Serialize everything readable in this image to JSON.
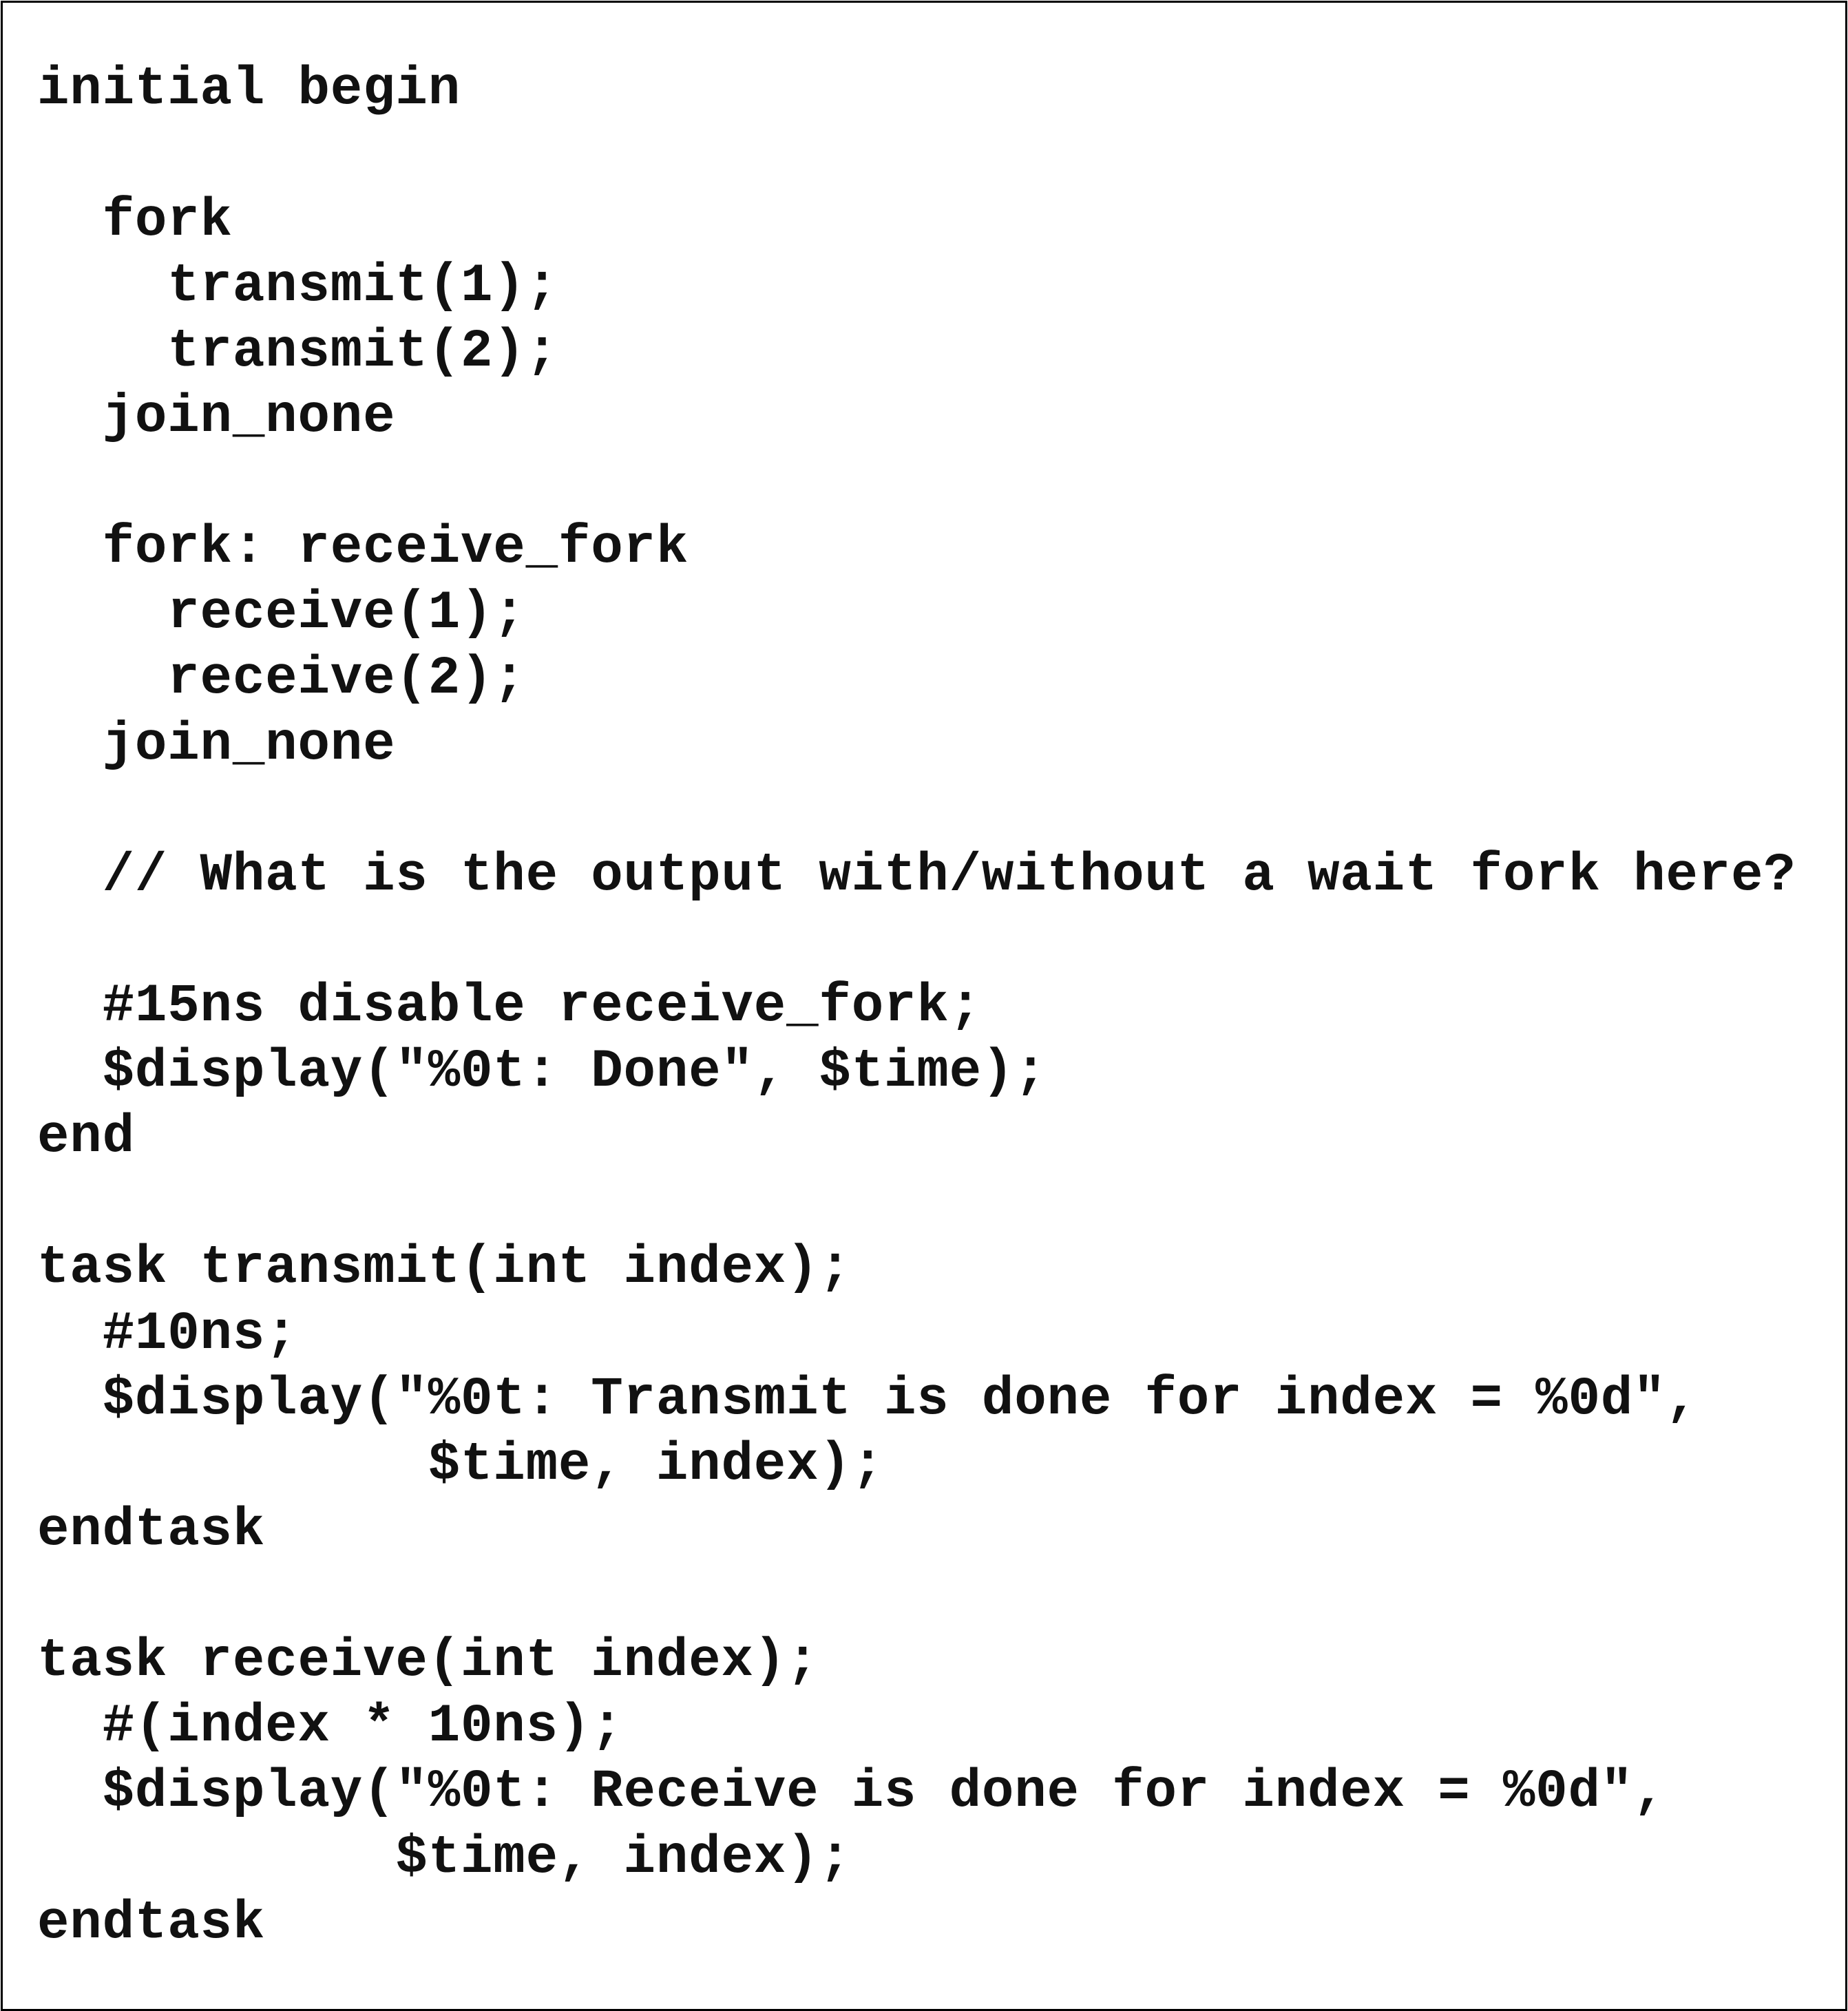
{
  "code": {
    "lines": [
      "initial begin",
      "",
      "  fork",
      "    transmit(1);",
      "    transmit(2);",
      "  join_none",
      "",
      "  fork: receive_fork",
      "    receive(1);",
      "    receive(2);",
      "  join_none",
      "",
      "  // What is the output with/without a wait fork here?",
      "",
      "  #15ns disable receive_fork;",
      "  $display(\"%0t: Done\", $time);",
      "end",
      "",
      "task transmit(int index);",
      "  #10ns;",
      "  $display(\"%0t: Transmit is done for index = %0d\",",
      "            $time, index);",
      "endtask",
      "",
      "task receive(int index);",
      "  #(index * 10ns);",
      "  $display(\"%0t: Receive is done for index = %0d\",",
      "           $time, index);",
      "endtask"
    ]
  }
}
